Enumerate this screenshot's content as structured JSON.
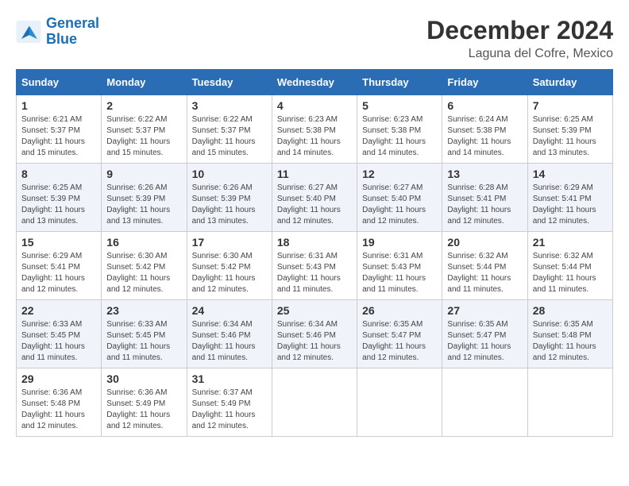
{
  "logo": {
    "line1": "General",
    "line2": "Blue"
  },
  "title": "December 2024",
  "subtitle": "Laguna del Cofre, Mexico",
  "days_of_week": [
    "Sunday",
    "Monday",
    "Tuesday",
    "Wednesday",
    "Thursday",
    "Friday",
    "Saturday"
  ],
  "weeks": [
    [
      {
        "day": "1",
        "sunrise": "6:21 AM",
        "sunset": "5:37 PM",
        "daylight": "11 hours and 15 minutes."
      },
      {
        "day": "2",
        "sunrise": "6:22 AM",
        "sunset": "5:37 PM",
        "daylight": "11 hours and 15 minutes."
      },
      {
        "day": "3",
        "sunrise": "6:22 AM",
        "sunset": "5:37 PM",
        "daylight": "11 hours and 15 minutes."
      },
      {
        "day": "4",
        "sunrise": "6:23 AM",
        "sunset": "5:38 PM",
        "daylight": "11 hours and 14 minutes."
      },
      {
        "day": "5",
        "sunrise": "6:23 AM",
        "sunset": "5:38 PM",
        "daylight": "11 hours and 14 minutes."
      },
      {
        "day": "6",
        "sunrise": "6:24 AM",
        "sunset": "5:38 PM",
        "daylight": "11 hours and 14 minutes."
      },
      {
        "day": "7",
        "sunrise": "6:25 AM",
        "sunset": "5:39 PM",
        "daylight": "11 hours and 13 minutes."
      }
    ],
    [
      {
        "day": "8",
        "sunrise": "6:25 AM",
        "sunset": "5:39 PM",
        "daylight": "11 hours and 13 minutes."
      },
      {
        "day": "9",
        "sunrise": "6:26 AM",
        "sunset": "5:39 PM",
        "daylight": "11 hours and 13 minutes."
      },
      {
        "day": "10",
        "sunrise": "6:26 AM",
        "sunset": "5:39 PM",
        "daylight": "11 hours and 13 minutes."
      },
      {
        "day": "11",
        "sunrise": "6:27 AM",
        "sunset": "5:40 PM",
        "daylight": "11 hours and 12 minutes."
      },
      {
        "day": "12",
        "sunrise": "6:27 AM",
        "sunset": "5:40 PM",
        "daylight": "11 hours and 12 minutes."
      },
      {
        "day": "13",
        "sunrise": "6:28 AM",
        "sunset": "5:41 PM",
        "daylight": "11 hours and 12 minutes."
      },
      {
        "day": "14",
        "sunrise": "6:29 AM",
        "sunset": "5:41 PM",
        "daylight": "11 hours and 12 minutes."
      }
    ],
    [
      {
        "day": "15",
        "sunrise": "6:29 AM",
        "sunset": "5:41 PM",
        "daylight": "11 hours and 12 minutes."
      },
      {
        "day": "16",
        "sunrise": "6:30 AM",
        "sunset": "5:42 PM",
        "daylight": "11 hours and 12 minutes."
      },
      {
        "day": "17",
        "sunrise": "6:30 AM",
        "sunset": "5:42 PM",
        "daylight": "11 hours and 12 minutes."
      },
      {
        "day": "18",
        "sunrise": "6:31 AM",
        "sunset": "5:43 PM",
        "daylight": "11 hours and 11 minutes."
      },
      {
        "day": "19",
        "sunrise": "6:31 AM",
        "sunset": "5:43 PM",
        "daylight": "11 hours and 11 minutes."
      },
      {
        "day": "20",
        "sunrise": "6:32 AM",
        "sunset": "5:44 PM",
        "daylight": "11 hours and 11 minutes."
      },
      {
        "day": "21",
        "sunrise": "6:32 AM",
        "sunset": "5:44 PM",
        "daylight": "11 hours and 11 minutes."
      }
    ],
    [
      {
        "day": "22",
        "sunrise": "6:33 AM",
        "sunset": "5:45 PM",
        "daylight": "11 hours and 11 minutes."
      },
      {
        "day": "23",
        "sunrise": "6:33 AM",
        "sunset": "5:45 PM",
        "daylight": "11 hours and 11 minutes."
      },
      {
        "day": "24",
        "sunrise": "6:34 AM",
        "sunset": "5:46 PM",
        "daylight": "11 hours and 11 minutes."
      },
      {
        "day": "25",
        "sunrise": "6:34 AM",
        "sunset": "5:46 PM",
        "daylight": "11 hours and 12 minutes."
      },
      {
        "day": "26",
        "sunrise": "6:35 AM",
        "sunset": "5:47 PM",
        "daylight": "11 hours and 12 minutes."
      },
      {
        "day": "27",
        "sunrise": "6:35 AM",
        "sunset": "5:47 PM",
        "daylight": "11 hours and 12 minutes."
      },
      {
        "day": "28",
        "sunrise": "6:35 AM",
        "sunset": "5:48 PM",
        "daylight": "11 hours and 12 minutes."
      }
    ],
    [
      {
        "day": "29",
        "sunrise": "6:36 AM",
        "sunset": "5:48 PM",
        "daylight": "11 hours and 12 minutes."
      },
      {
        "day": "30",
        "sunrise": "6:36 AM",
        "sunset": "5:49 PM",
        "daylight": "11 hours and 12 minutes."
      },
      {
        "day": "31",
        "sunrise": "6:37 AM",
        "sunset": "5:49 PM",
        "daylight": "11 hours and 12 minutes."
      },
      null,
      null,
      null,
      null
    ]
  ],
  "labels": {
    "sunrise": "Sunrise:",
    "sunset": "Sunset:",
    "daylight": "Daylight:"
  }
}
